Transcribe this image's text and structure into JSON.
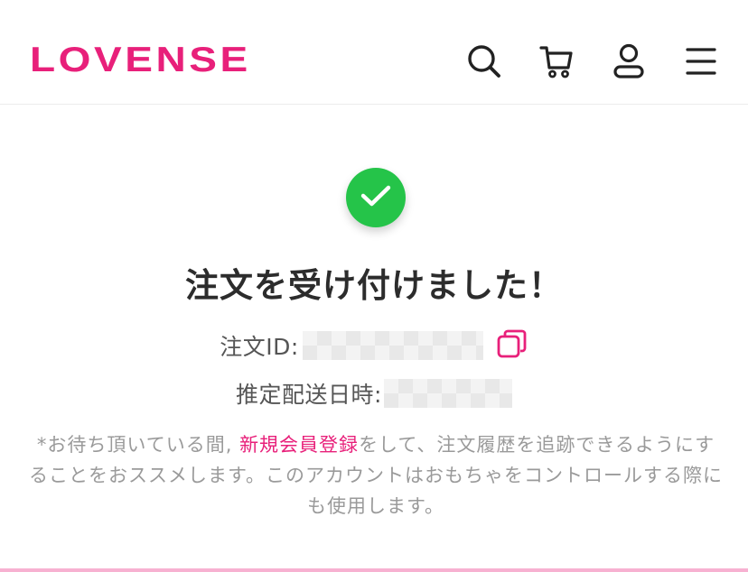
{
  "header": {
    "logo_text": "LOVENSE",
    "icons": [
      "search-icon",
      "cart-icon",
      "user-icon",
      "menu-icon"
    ]
  },
  "confirmation": {
    "icon": "check-icon",
    "title": "注文を受け付けました！",
    "order_id_label": "注文ID:",
    "shipping_label": "推定配送日時:",
    "note_prefix": "*お待ち頂いている間, ",
    "note_link": "新規会員登録",
    "note_suffix": "をして、注文履歴を追跡できるようにすることをおススメします。このアカウントはおもちゃをコントロールする際にも使用します。"
  },
  "colors": {
    "brand": "#e8207a",
    "success": "#25c449",
    "text": "#2c2c2c",
    "muted": "#9a9a9a"
  }
}
